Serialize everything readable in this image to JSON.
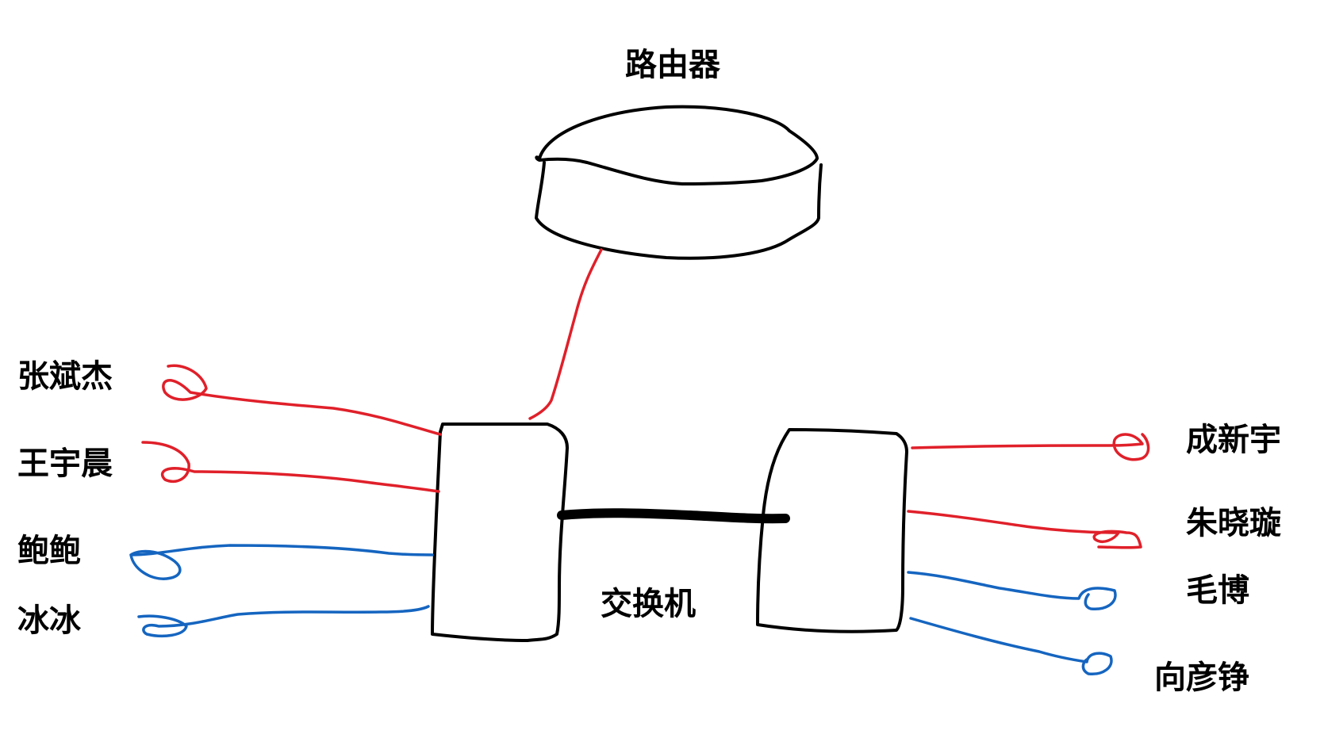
{
  "labels": {
    "router": "路由器",
    "switch": "交换机",
    "left_clients": [
      "张斌杰",
      "王宇晨",
      "鲍鲍",
      "冰冰"
    ],
    "right_clients": [
      "成新宇",
      "朱晓璇",
      "毛博",
      "向彦铮"
    ]
  },
  "colors": {
    "outline": "#000000",
    "red_link": "#e0202a",
    "blue_link": "#1565c0"
  },
  "link_colors": {
    "router_uplink": "red",
    "left_clients": [
      "red",
      "red",
      "blue",
      "blue"
    ],
    "right_clients": [
      "red",
      "red",
      "blue",
      "blue"
    ]
  }
}
